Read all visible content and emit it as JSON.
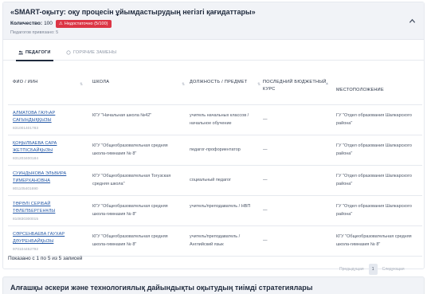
{
  "header": {
    "title": "«SMART-оқыту: оқу процесін ұйымдастырудың негізгі қағидаттары»",
    "qty_label": "Количество:",
    "qty_value": "100",
    "badge_text": "Недостаточно (5/100)",
    "attached_text": "Педагогов привязано: 5"
  },
  "tabs": [
    {
      "label": "ПЕДАГОГИ",
      "icon": "users-icon",
      "active": true
    },
    {
      "label": "ГОРЯЧИЕ ЗАМЕНЫ",
      "icon": "circle-icon",
      "active": false
    }
  ],
  "table": {
    "headers": {
      "name": "ФИО / ИИН",
      "school": "ШКОЛА",
      "position": "ДОЛЖНОСТЬ / ПРЕДМЕТ",
      "last_course": "ПОСЛЕДНИЙ БЮДЖЕТНЫЙ КУРС",
      "location": "МЕСТОПОЛОЖЕНИЕ"
    },
    "rows": [
      {
        "name": "АЛМАТОВА ГАУҺАР САҒЫНДЫҚҚЫЗЫ",
        "iin": "831001401783",
        "school": "КГУ \"Начальная школа №42\"",
        "position": "учитель начальных классов / начальное обучение",
        "last_course": "—",
        "location": "ГУ \"Отдел образования Шалкарского района\""
      },
      {
        "name": "ҚОҢЫЛБАЕВА САРА ЖЕТПІСБАЙҚЫЗЫ",
        "iin": "831203400184",
        "school": "КГУ \"Общеобразовательная средняя школа-гимназия № 8\"",
        "position": "педагог-профориентатор",
        "last_course": "—",
        "location": "ГУ \"Отдел образования Шалкарского района\""
      },
      {
        "name": "СУИНДЫКОВА ЭЛЬВИРА ТИМЕРХАНОВНА",
        "iin": "801105401690",
        "school": "КГУ \"Общеобразовательная Тогузская средняя школа\"",
        "position": "социальный педагог",
        "last_course": "—",
        "location": "ГУ \"Отдел образования Шалкарского района\""
      },
      {
        "name": "ТӨРӘЛІ СЕРІБАЙ ТӨЛЕПБЕРГЕНҰЛЫ",
        "iin": "810830300015",
        "school": "КГУ \"Общеобразовательная средняя школа-гимназия № 8\"",
        "position": "учитель/преподаватель / НВП",
        "last_course": "—",
        "location": "ГУ \"Отдел образования Шалкарского района\""
      },
      {
        "name": "СӘРСЕНБАЕВА ГАУХАР ДӘУРЕНБАЙҚЫЗЫ",
        "iin": "970104452792",
        "school": "КГУ \"Общеобразовательная средняя школа-гимназия № 8\"",
        "position": "учитель/преподаватель / Английский язык",
        "last_course": "—",
        "location": "КГУ \"Общеобразовательная средняя школа-гимназия № 8\""
      }
    ]
  },
  "footer": {
    "info": "Показано с 1 по 5 из 5 записей",
    "prev": "Предыдущая",
    "page": "1",
    "next": "Следующая"
  },
  "next_card": {
    "title": "Алғашқы әскери және технологиялық дайындықты оқытудың тиімді стратегиялары"
  },
  "colors": {
    "badge": "#dc3545",
    "link": "#2458a7",
    "header_bg": "#f1f3f7"
  }
}
